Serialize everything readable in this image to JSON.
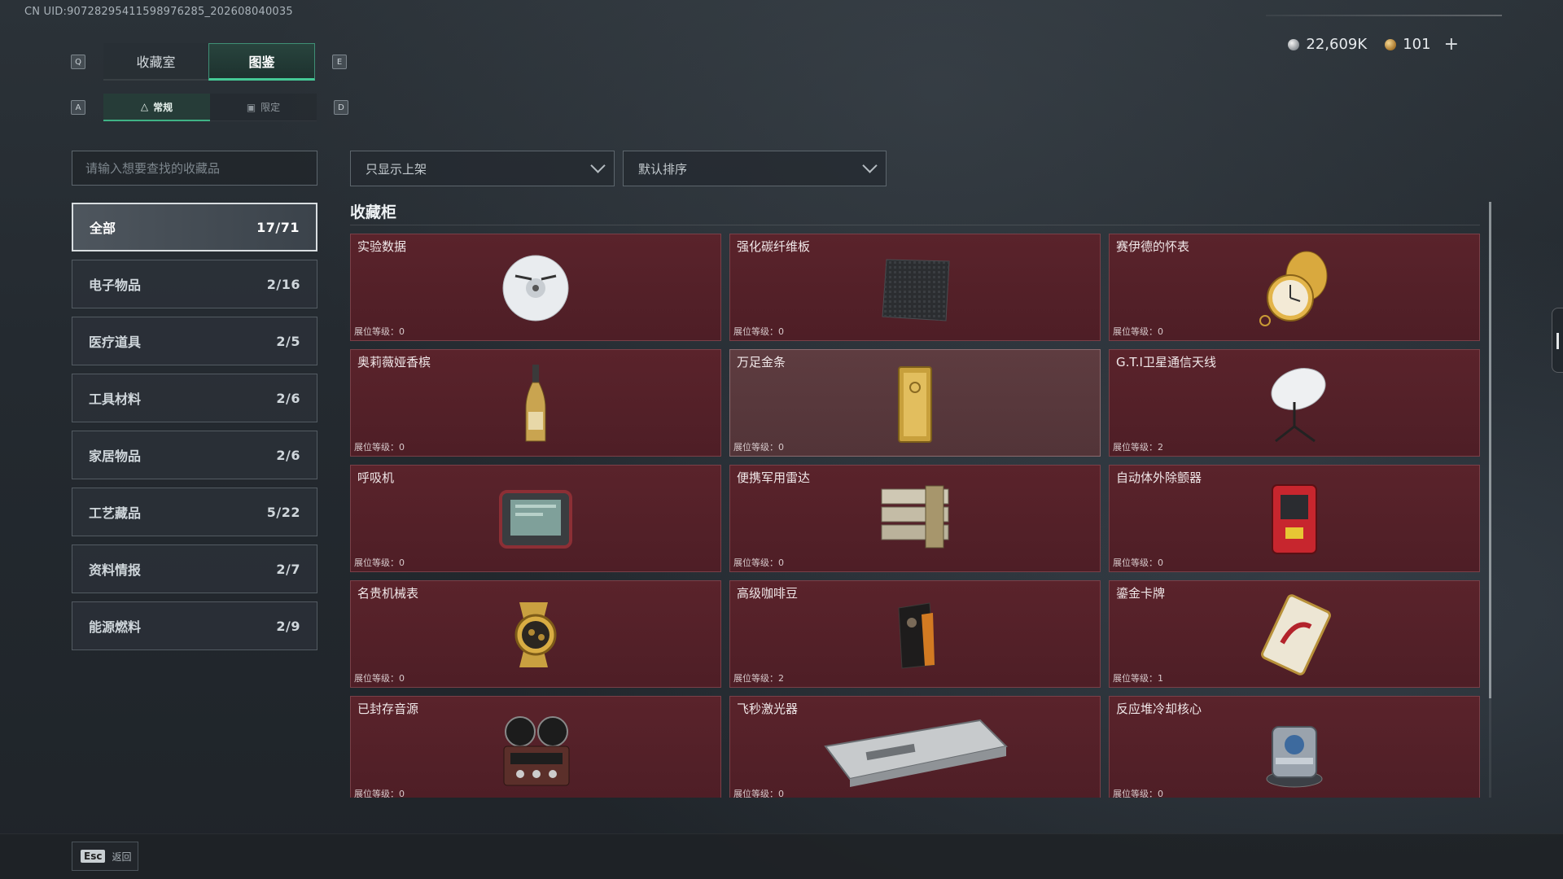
{
  "uid": "CN UID:9072829541159897628​5_202608040035",
  "currency": {
    "silver": "22,609K",
    "gold": "101",
    "plus": "+"
  },
  "keys": {
    "prev_tab": "Q",
    "next_tab": "E",
    "prev_sub": "A",
    "next_sub": "D"
  },
  "tabs": [
    {
      "label": "收藏室"
    },
    {
      "label": "图鉴"
    }
  ],
  "subtabs": [
    {
      "label": "常规"
    },
    {
      "label": "限定"
    }
  ],
  "search": {
    "placeholder": "请输入想要查找的收藏品"
  },
  "filters": {
    "display": "只显示上架",
    "sort": "默认排序"
  },
  "categories": [
    {
      "label": "全部",
      "count": "17/71"
    },
    {
      "label": "电子物品",
      "count": "2/16"
    },
    {
      "label": "医疗道具",
      "count": "2/5"
    },
    {
      "label": "工具材料",
      "count": "2/6"
    },
    {
      "label": "家居物品",
      "count": "2/6"
    },
    {
      "label": "工艺藏品",
      "count": "5/22"
    },
    {
      "label": "资料情报",
      "count": "2/7"
    },
    {
      "label": "能源燃料",
      "count": "2/9"
    }
  ],
  "section": {
    "title": "收藏柜"
  },
  "items": [
    {
      "name": "实验数据",
      "level": "展位等级：0",
      "icon": "disc-icon"
    },
    {
      "name": "强化碳纤维板",
      "level": "展位等级：0",
      "icon": "carbon-plate-icon"
    },
    {
      "name": "赛伊德的怀表",
      "level": "展位等级：0",
      "icon": "pocket-watch-icon"
    },
    {
      "name": "奥莉薇娅香槟",
      "level": "展位等级：0",
      "icon": "champagne-bottle-icon"
    },
    {
      "name": "万足金条",
      "level": "展位等级：0",
      "icon": "gold-bar-icon"
    },
    {
      "name": "G.T.I卫星通信天线",
      "level": "展位等级：2",
      "icon": "satellite-dish-icon"
    },
    {
      "name": "呼吸机",
      "level": "展位等级：0",
      "icon": "ventilator-icon"
    },
    {
      "name": "便携军用雷达",
      "level": "展位等级：0",
      "icon": "military-radar-icon"
    },
    {
      "name": "自动体外除颤器",
      "level": "展位等级：0",
      "icon": "defibrillator-icon"
    },
    {
      "name": "名贵机械表",
      "level": "展位等级：0",
      "icon": "wristwatch-icon"
    },
    {
      "name": "高级咖啡豆",
      "level": "展位等级：2",
      "icon": "coffee-bag-icon"
    },
    {
      "name": "鎏金卡牌",
      "level": "展位等级：1",
      "icon": "gilded-card-icon"
    },
    {
      "name": "已封存音源",
      "level": "展位等级：0",
      "icon": "reel-recorder-icon"
    },
    {
      "name": "飞秒激光器",
      "level": "展位等级：0",
      "icon": "laser-device-icon"
    },
    {
      "name": "反应堆冷却核心",
      "level": "展位等级：0",
      "icon": "reactor-core-icon"
    }
  ],
  "footer": {
    "esc_key": "Esc",
    "back_label": "返回"
  }
}
